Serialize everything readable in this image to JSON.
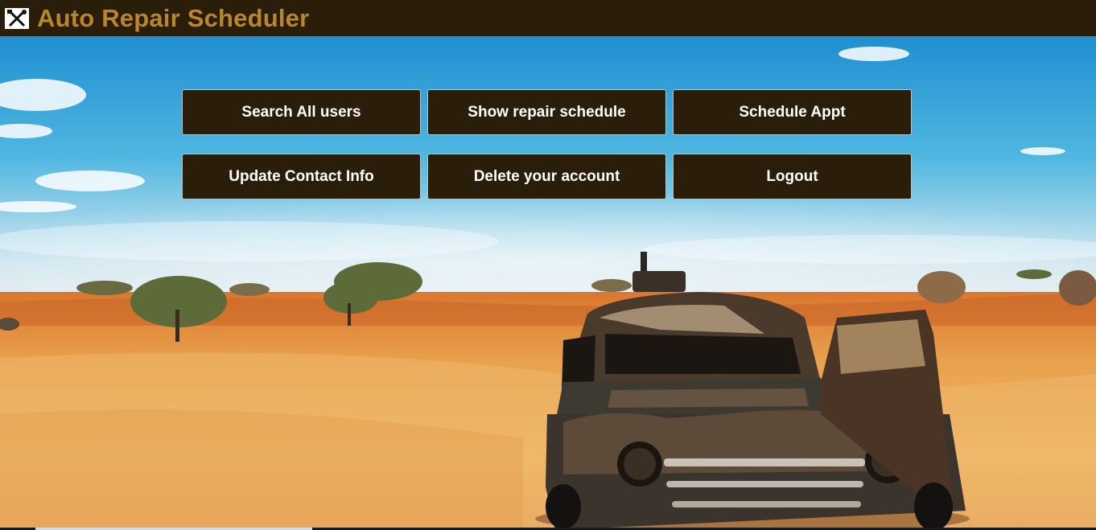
{
  "app": {
    "title": "Auto Repair Scheduler",
    "logo_icon": "wrench-screwdriver-icon"
  },
  "nav": {
    "buttons": [
      {
        "label": "Search All users"
      },
      {
        "label": "Show repair schedule"
      },
      {
        "label": "Schedule Appt"
      },
      {
        "label": "Update Contact Info"
      },
      {
        "label": "Delete your account"
      },
      {
        "label": "Logout"
      }
    ]
  },
  "background": {
    "icon": "desert-wrecked-car-photo"
  },
  "colors": {
    "header_bg": "#2a1d0a",
    "title_text": "#b8862d",
    "button_bg": "#2a1d0a",
    "button_text": "#ffffff",
    "sky": "#3aa6d6",
    "sand": "#e8a24a"
  }
}
